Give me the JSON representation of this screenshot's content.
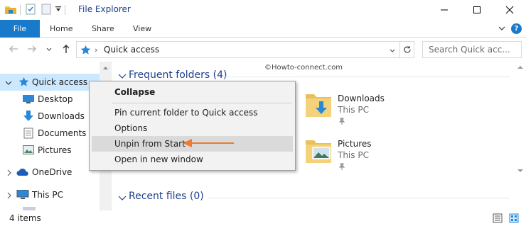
{
  "window": {
    "title": "File Explorer"
  },
  "ribbon": {
    "file": "File",
    "tabs": [
      "Home",
      "Share",
      "View"
    ]
  },
  "address": {
    "path": "Quick access",
    "search_placeholder": "Search Quick acc..."
  },
  "nav": {
    "items": [
      {
        "label": "Quick access",
        "icon": "star-icon",
        "selected": true
      },
      {
        "label": "Desktop",
        "icon": "desktop-icon"
      },
      {
        "label": "Downloads",
        "icon": "download-icon"
      },
      {
        "label": "Documents",
        "icon": "document-icon"
      },
      {
        "label": "Pictures",
        "icon": "pictures-icon"
      },
      {
        "label": "OneDrive",
        "icon": "cloud-icon"
      },
      {
        "label": "This PC",
        "icon": "computer-icon"
      }
    ]
  },
  "content": {
    "frequent_header": "Frequent folders (4)",
    "recent_header": "Recent files (0)",
    "watermark": "©Howto-connect.com",
    "folders": [
      {
        "name": "Downloads",
        "location": "This PC"
      },
      {
        "name": "Pictures",
        "location": "This PC"
      }
    ]
  },
  "context_menu": {
    "items": [
      {
        "label": "Collapse",
        "bold": true
      },
      {
        "label": "Pin current folder to Quick access"
      },
      {
        "label": "Options"
      },
      {
        "label": "Unpin from Start",
        "highlighted": true
      },
      {
        "label": "Open in new window"
      }
    ]
  },
  "status": {
    "items": "4 items"
  },
  "colors": {
    "accent": "#1979ca",
    "selection": "#cce8ff",
    "arrow": "#f07a30"
  }
}
